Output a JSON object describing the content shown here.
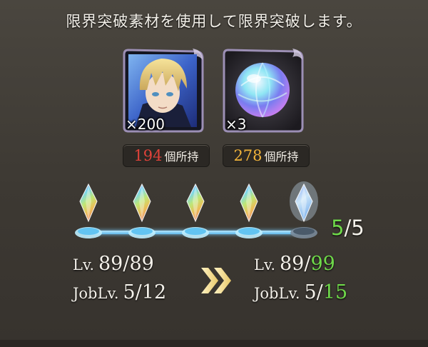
{
  "instruction": "限界突破素材を使用して限界突破します。",
  "materials": [
    {
      "icon": "character-portrait-icon",
      "quantity": "×200",
      "owned_count": "194",
      "owned_label": "個所持",
      "owned_color": "#e0423a"
    },
    {
      "icon": "crystal-orb-icon",
      "quantity": "×3",
      "owned_count": "278",
      "owned_label": "個所持",
      "owned_color": "#f1b33a"
    }
  ],
  "limit_break": {
    "current": "5",
    "max": "/5",
    "crystals_lit": 4,
    "crystals_total": 5
  },
  "before": {
    "lv_label": "Lv.",
    "lv_value": "89/89",
    "job_label": "JobLv.",
    "job_value": "5/12"
  },
  "after": {
    "lv_label": "Lv.",
    "lv_value": "89/",
    "lv_max": "99",
    "job_label": "JobLv.",
    "job_value": "5/",
    "job_max": "15"
  },
  "colors": {
    "accent_green": "#6fd94a",
    "owned_red": "#e0423a",
    "owned_gold": "#f1b33a"
  }
}
